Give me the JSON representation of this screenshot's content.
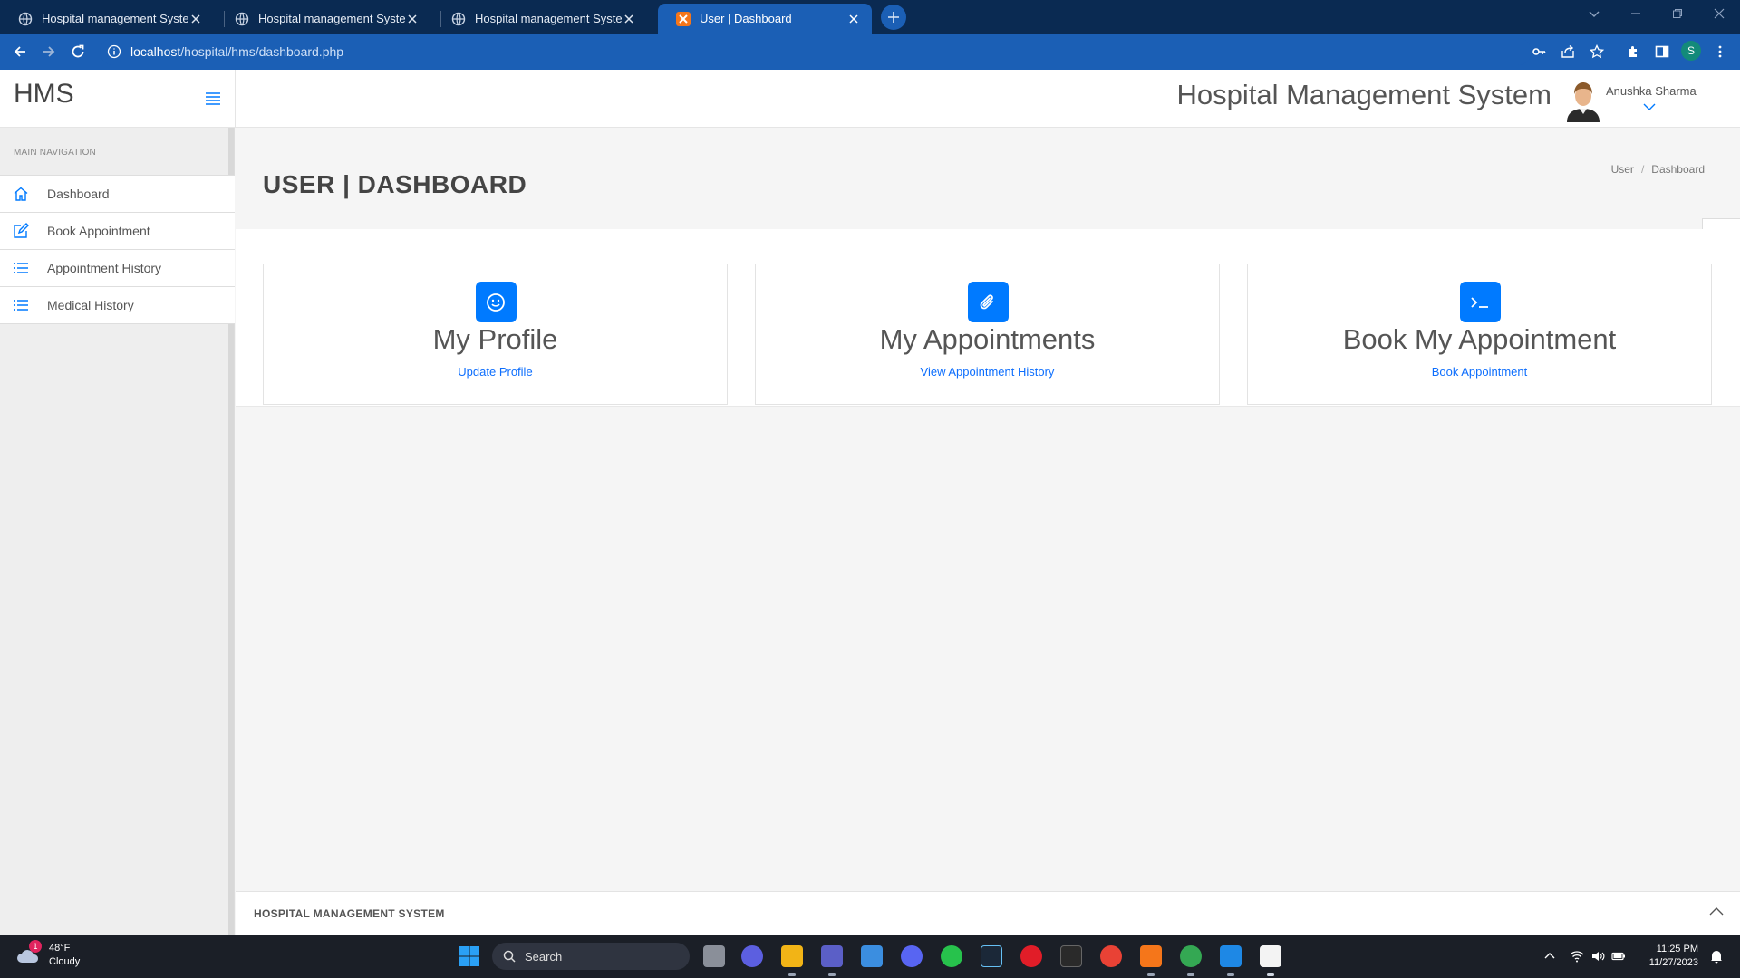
{
  "browser": {
    "tabs": [
      {
        "title": "Hospital management System",
        "active": false
      },
      {
        "title": "Hospital management System",
        "active": false
      },
      {
        "title": "Hospital management System",
        "active": false
      },
      {
        "title": "User | Dashboard",
        "active": true
      }
    ],
    "url_host": "localhost",
    "url_path": "/hospital/hms/dashboard.php",
    "profile_initial": "S"
  },
  "app": {
    "brand": "HMS",
    "header_title": "Hospital Management System",
    "user_name": "Anushka Sharma",
    "accent_color": "#007aff"
  },
  "sidebar": {
    "heading": "MAIN NAVIGATION",
    "items": [
      {
        "label": "Dashboard",
        "icon": "home-icon"
      },
      {
        "label": "Book Appointment",
        "icon": "edit-icon"
      },
      {
        "label": "Appointment History",
        "icon": "list-icon"
      },
      {
        "label": "Medical History",
        "icon": "list-icon"
      }
    ]
  },
  "page": {
    "title": "USER | DASHBOARD",
    "breadcrumb": [
      "User",
      "Dashboard"
    ]
  },
  "cards": [
    {
      "title": "My Profile",
      "link": "Update Profile",
      "icon": "smile-icon"
    },
    {
      "title": "My Appointments",
      "link": "View Appointment History",
      "icon": "paperclip-icon"
    },
    {
      "title": "Book My Appointment",
      "link": "Book Appointment",
      "icon": "terminal-icon"
    }
  ],
  "footer": {
    "text": "HOSPITAL MANAGEMENT SYSTEM"
  },
  "taskbar": {
    "weather_temp": "48°F",
    "weather_desc": "Cloudy",
    "weather_badge": "1",
    "search_placeholder": "Search",
    "time": "11:25 PM",
    "date": "11/27/2023"
  }
}
